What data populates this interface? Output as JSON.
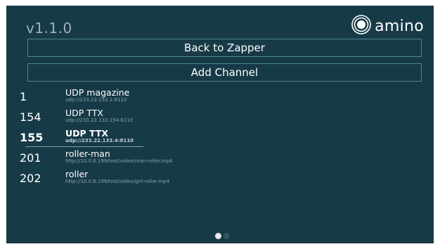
{
  "header": {
    "version": "v1.1.0",
    "brand": {
      "name": "amino",
      "icon": "amino-logo-icon"
    }
  },
  "menu": {
    "back_label": "Back to Zapper",
    "add_label": "Add Channel"
  },
  "channels": [
    {
      "number": "1",
      "name": "UDP magazine",
      "url": "udp://233.22.133.1:8110"
    },
    {
      "number": "154",
      "name": "UDP TTX",
      "url": "udp://233.22.133.154:8110"
    },
    {
      "number": "155",
      "name": "UDP TTX",
      "url": "udp://233.22.133.4:8110",
      "selected": true
    },
    {
      "number": "201",
      "name": "roller-man",
      "url": "http://10.0.6.199/test/video/man-roller.mp4"
    },
    {
      "number": "202",
      "name": "roller",
      "url": "http://10.0.6.199/test/video/girl-roller.mp4"
    }
  ],
  "pager": {
    "pages": 2,
    "current": 1
  },
  "colors": {
    "background": "#173a47",
    "button_border": "#4c8592",
    "text": "#ffffff",
    "muted": "#8aa3aa"
  }
}
